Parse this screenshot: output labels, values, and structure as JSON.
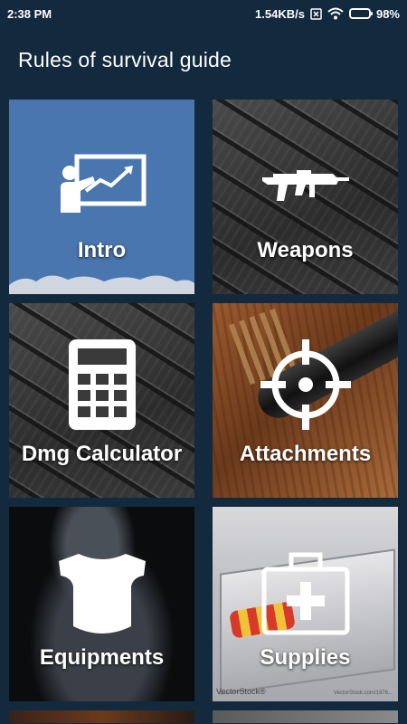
{
  "status": {
    "time": "2:38 PM",
    "network_speed": "1.54KB/s",
    "battery": "98%",
    "battery_level": 0.98
  },
  "appbar": {
    "title": "Rules of survival guide"
  },
  "tiles": [
    {
      "label": "Intro",
      "icon": "presentation-icon"
    },
    {
      "label": "Weapons",
      "icon": "rifle-icon"
    },
    {
      "label": "Dmg Calculator",
      "icon": "calculator-icon"
    },
    {
      "label": "Attachments",
      "icon": "crosshair-icon"
    },
    {
      "label": "Equipments",
      "icon": "vest-icon"
    },
    {
      "label": "Supplies",
      "icon": "medkit-icon"
    }
  ],
  "supplies_watermark": "VectorStock®",
  "supplies_watermark_small": "VectorStock.com/1976..."
}
